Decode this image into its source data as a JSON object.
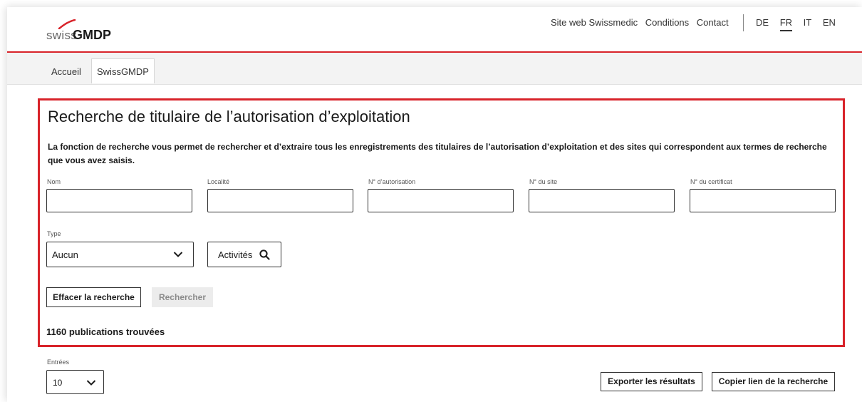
{
  "header": {
    "logo_swiss": "swiss",
    "logo_gmdp": "GMDP",
    "links": [
      "Site web Swissmedic",
      "Conditions",
      "Contact"
    ],
    "languages": [
      "DE",
      "FR",
      "IT",
      "EN"
    ],
    "active_language": "FR"
  },
  "nav": {
    "tabs": [
      "Accueil",
      "SwissGMDP"
    ],
    "active_tab": "SwissGMDP"
  },
  "search": {
    "title": "Recherche de titulaire de l’autorisation d’exploitation",
    "intro": "La fonction de recherche vous permet de rechercher et d’extraire tous les enregistrements des titulaires de l’autorisation d’exploitation et des sites qui correspondent aux termes de recherche que vous avez saisis.",
    "fields": [
      {
        "label": "Nom",
        "value": ""
      },
      {
        "label": "Localité",
        "value": ""
      },
      {
        "label": "N° d’autorisation",
        "value": ""
      },
      {
        "label": "N° du site",
        "value": ""
      },
      {
        "label": "N° du certificat",
        "value": ""
      }
    ],
    "type_label": "Type",
    "type_value": "Aucun",
    "activites_label": "Activités",
    "clear_label": "Effacer la recherche",
    "search_label": "Rechercher",
    "results_count": "1160 publications trouvées"
  },
  "results": {
    "entries_label": "Entrées",
    "entries_value": "10",
    "export_label": "Exporter les résultats",
    "copy_link_label": "Copier lien de la recherche"
  },
  "colors": {
    "accent_red": "#d8232a",
    "disabled_bg": "#ececec",
    "nav_bg": "#f3f3f3"
  },
  "icons": {
    "logo_swoosh": "swoosh-icon",
    "select_caret": "chevron-down-icon",
    "activites": "search-icon"
  }
}
